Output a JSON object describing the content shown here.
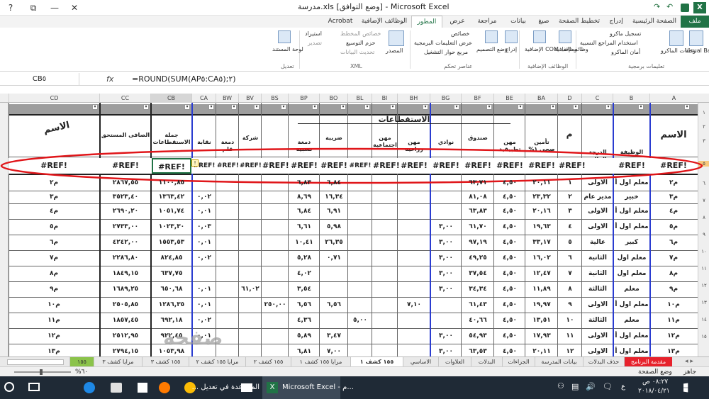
{
  "window": {
    "title": "مدرسة.xls  [وضع التوافق] - Microsoft Excel",
    "help": "?",
    "restore": "⧉",
    "minimize": "—",
    "close": "✕"
  },
  "quick_access": {
    "save_icon": "save-icon",
    "undo_icon": "undo-icon",
    "redo_icon": "redo-icon"
  },
  "tabs": [
    "ملف",
    "الصفحة الرئيسية",
    "إدراج",
    "تخطيط الصفحة",
    "صيغ",
    "بيانات",
    "مراجعة",
    "عرض",
    "المطور",
    "الوظائف الإضافية",
    "Acrobat"
  ],
  "active_tab": "المطور",
  "ribbon": {
    "code": {
      "label": "تعليمات برمجية",
      "visual_basic": "Visual Basic",
      "macros": "وحدات الماكرو",
      "record_macro": "تسجيل ماكرو",
      "relative_refs": "استخدام المراجع النسبية",
      "macro_security": "أمان الماكرو"
    },
    "addins": {
      "label": "الوظائف الإضافية",
      "addins": "وظائف إضافية",
      "com_addins": "وظائف COM الإضافية"
    },
    "controls": {
      "label": "عناصر تحكم",
      "insert": "إدراج",
      "design_mode": "وضع التصميم",
      "properties": "خصائص",
      "view_code": "عرض التعليمات البرمجية",
      "run_dialog": "مربع حوار التشغيل"
    },
    "xml": {
      "label": "XML",
      "source": "المصدر",
      "map_properties": "خصائص المخطط",
      "expansion_packs": "حزم التوسيع",
      "refresh_data": "تحديث البيانات",
      "import": "استيراد",
      "export": "تصدير"
    },
    "modify": {
      "label": "تعديل",
      "document_panel": "لوحة المستند"
    }
  },
  "formula_bar": {
    "name_box": "CB٥",
    "fx": "fx",
    "formula": "=ROUND(SUM(AP٥:CA٥);٢)"
  },
  "columns": [
    "A",
    "B",
    "C",
    "D",
    "BA",
    "BE",
    "BF",
    "BG",
    "BH",
    "BI",
    "BL",
    "BO",
    "BP",
    "BS",
    "BV",
    "BW",
    "CA",
    "CB",
    "CC",
    "CD"
  ],
  "headers": {
    "name": "الاسم",
    "deductions": "الاستقطاعات",
    "total_deductions": "جملة الاستقطاعات",
    "net_due": "الصافى المستحق",
    "m": "م",
    "insurance": "تأمين صحي ١%",
    "fund": "صندوق",
    "professions": "مهن تطبيقية",
    "clubs": "نوادي",
    "profession_ed": "مهن زراعية",
    "profession_social": "مهن اجتماعية",
    "tax": "ضريبة",
    "stamp": "دمغة نسبية",
    "company": "شركة",
    "pens": "دمغة قلم",
    "union": "نقابة",
    "grade": "الدرجة المالية",
    "job": "الوظيفة",
    "signature": "الاسم"
  },
  "ref_row": [
    "#REF!",
    "#REF!",
    "#REF!",
    "#REF!",
    "#REF!",
    "#REF!",
    "#REF!",
    "#REF!",
    "#REF!",
    "#REF!",
    "#REF!",
    "#REF!",
    "#REF!",
    "#REF!",
    "#REF!",
    "#REF!",
    "#REF!",
    "#REF!"
  ],
  "rows": [
    {
      "num": "م٢",
      "job": "معلم اول أ",
      "grade": "الاولى",
      "m": "١",
      "ins": "٢٠,١١",
      "fund": "٤,٥٠",
      "prof": "٦٣,٧١",
      "clubs": "",
      "tax": "٦,٨٤",
      "stamp": "٦,٨٣",
      "ca": "",
      "cb": "١١٠٠,٨٥",
      "cc": "٢٨٦٧,٥٥",
      "cd": "م٢"
    },
    {
      "num": "م٣",
      "job": "خبير",
      "grade": "مدير عام",
      "m": "٢",
      "ins": "٢٣,٣٢",
      "fund": "٤,٥٠",
      "prof": "٨١,٠٨",
      "clubs": "",
      "tax": "١٦,٣٤",
      "stamp": "٨,٦٩",
      "ca": "٠,٠٢",
      "cb": "١٣٦٣,٤٢",
      "cc": "٣٥٢٣,٤٠",
      "cd": "م٣"
    },
    {
      "num": "م٤",
      "job": "معلم اول أ",
      "grade": "الاولى",
      "m": "٣",
      "ins": "٢٠,١٦",
      "fund": "٤,٥٠",
      "prof": "٦٣,٨٣",
      "clubs": "",
      "tax": "٦,٩١",
      "stamp": "٦,٨٤",
      "ca": "٠,٠١",
      "cb": "١٠٥١,٧٤",
      "cc": "٢٦٩٠,٢٠",
      "cd": "م٤"
    },
    {
      "num": "م٥",
      "job": "معلم اول أ",
      "grade": "الاولى",
      "m": "٤",
      "ins": "١٩,٦٣",
      "fund": "٤,٥٠",
      "prof": "٦١,٧٠",
      "clubs": "٣,٠٠",
      "tax": "٥,٩٨",
      "stamp": "٦,٦١",
      "ca": "٠,٠٣",
      "cb": "١٠٢٣,٣٠",
      "cc": "٢٧٣٣,٠٠",
      "cd": "م٥"
    },
    {
      "num": "م٦",
      "job": "كبير",
      "grade": "عالية",
      "m": "٥",
      "ins": "٣٣,١٧",
      "fund": "٤,٥٠",
      "prof": "٩٧,١٩",
      "clubs": "٣,٠٠",
      "tax": "٢٦,٣٥",
      "stamp": "١٠,٤١",
      "ca": "٠,٠١",
      "cb": "١٥٥٣,٥٣",
      "cc": "٤٢٤٢,٠٠",
      "cd": "م٦"
    },
    {
      "num": "م٧",
      "job": "معلم اول",
      "grade": "الثانية",
      "m": "٦",
      "ins": "١٦,٠٢",
      "fund": "٤,٥٠",
      "prof": "٤٩,٢٥",
      "clubs": "٣,٠٠",
      "tax": "٠,٧١",
      "stamp": "٥,٢٨",
      "ca": "٠,٠٢",
      "cb": "٨٢٤,٨٥",
      "cc": "٢٢٨٦,٨٠",
      "cd": "م٧"
    },
    {
      "num": "م٨",
      "job": "معلم اول",
      "grade": "الثانية",
      "m": "٧",
      "ins": "١٢,٤٧",
      "fund": "٤,٥٠",
      "prof": "٣٧,٥٤",
      "clubs": "٣,٠٠",
      "tax": "",
      "stamp": "٤,٠٢",
      "ca": "",
      "cb": "٦٣٧,٧٥",
      "cc": "١٨٤٩,١٥",
      "cd": "م٨"
    },
    {
      "num": "م٩",
      "job": "معلم",
      "grade": "الثالثة",
      "m": "٨",
      "ins": "١١,٨٩",
      "fund": "٤,٥٠",
      "prof": "٣٤,٣٤",
      "clubs": "٣,٠٠",
      "tax": "",
      "stamp": "٣,٥٤",
      "ca": "٠,٠١",
      "cb": "٦٥٠,٦٨",
      "cc": "١٦٨٩,٢٥",
      "cd": "م٩",
      "bv": "٦١,٠٢"
    },
    {
      "num": "م١٠",
      "job": "معلم اول أ",
      "grade": "الاولى",
      "m": "٩",
      "ins": "١٩,٩٧",
      "fund": "٤,٥٠",
      "prof": "٦١,٤٣",
      "clubs": "",
      "tax": "٦,٥٦",
      "stamp": "٦,٥٦",
      "ca": "٠,٠١",
      "cb": "١٢٨٦,٣٥",
      "cc": "٢٥٠٥,٨٥",
      "cd": "م١٠",
      "bs": "٢٥٠,٠٠",
      "bh": "٧,١٠"
    },
    {
      "num": "م١١",
      "job": "معلم",
      "grade": "الثالثة",
      "m": "١٠",
      "ins": "١٣,٥١",
      "fund": "٤,٥٠",
      "prof": "٤٠,٦٦",
      "clubs": "",
      "tax": "",
      "stamp": "٤,٣٦",
      "ca": "٠,٠٢",
      "cb": "٦٩٢,١٨",
      "cc": "١٨٥٧,٤٥",
      "cd": "م١١",
      "bl": "٥,٠٠"
    },
    {
      "num": "م١٢",
      "job": "معلم اول أ",
      "grade": "الاولى",
      "m": "١١",
      "ins": "١٧,٩٣",
      "fund": "٤,٥٠",
      "prof": "٥٤,٩٣",
      "clubs": "٣,٠٠",
      "tax": "٣,٤٧",
      "stamp": "٥,٨٩",
      "ca": "٠,٠١",
      "cb": "٩٢٢,٤٥",
      "cc": "٢٥١٢,٩٥",
      "cd": "م١٢"
    },
    {
      "num": "م١٣",
      "job": "معلم اول أ",
      "grade": "الاولى",
      "m": "١٢",
      "ins": "٢٠,١١",
      "fund": "٤,٥٠",
      "prof": "٦٣,٥٣",
      "clubs": "٣,٠٠",
      "tax": "٧,٠٠",
      "stamp": "٦,٨١",
      "ca": "",
      "cb": "١٠٥٣,٩٨",
      "cc": "٢٧٩٤,١٥",
      "cd": "م١٣"
    }
  ],
  "row_numbers": [
    "١",
    "٢",
    "٣",
    "٤",
    "٥",
    "٦",
    "٧",
    "٨",
    "٩",
    "١٠",
    "١١",
    "١٢",
    "١٣",
    "١٤",
    "١٥",
    "١٦",
    "١٧"
  ],
  "sheet_tabs": [
    "مقدمة البرنامج",
    "حذف البدلات",
    "بيانات المدرسة",
    "الجزاءات",
    "البدلات",
    "العلاوات",
    "الاساسي",
    "١٥٥ كشف ١",
    "مرايا ١٥٥ كشف ١",
    "١٥٥ كشف ٢",
    "مرايا ١٥٥ كشف ٢",
    "١٥٥ كشف ٣",
    "مرايا كشف ٣",
    "١٥٥"
  ],
  "active_sheet": "١٥٥ كشف ١",
  "status": {
    "ready": "جاهز",
    "page_layout": "وضع الصفحة",
    "zoom": "%٦٠"
  },
  "taskbar": {
    "excel": "Microsoft Excel - م...",
    "help": "المساعدة في تعديل ...",
    "time": "٠٨:٢٧ ص",
    "date": "٢٠١٨/٠٤/٢١",
    "lang": "ع"
  },
  "watermark": "صفحة"
}
